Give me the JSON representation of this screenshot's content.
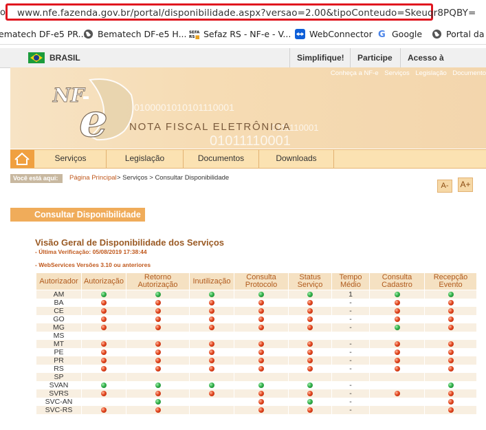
{
  "browser": {
    "url_prefix": "o",
    "url": "www.nfe.fazenda.gov.br/portal/disponibilidade.aspx?versao=2.00&tipoConteudo=Skeuqr8PQBY=",
    "bookmarks": [
      "ematech DF-e5 PR...",
      "Bematech DF-e5 H...",
      "Sefaz RS - NF-e - V...",
      "WebConnector",
      "Google",
      "Portal da N"
    ]
  },
  "gov_bar": {
    "country": "BRASIL",
    "links": [
      "Simplifique!",
      "Participe",
      "Acesso à informação"
    ]
  },
  "banner": {
    "top_links": [
      "Conheça a NF-e",
      "Serviços",
      "Legislação",
      "Documento"
    ],
    "logo_text": "NF-e",
    "title": "NOTA FISCAL ELETRÔNICA",
    "binary_1": "0100001010101110001",
    "binary_2": "0111110001",
    "binary_3": "01011110001"
  },
  "nav": {
    "items": [
      "Serviços",
      "Legislação",
      "Documentos",
      "Downloads"
    ]
  },
  "breadcrumb": {
    "label": "Você está aqui:",
    "home": "Página Principal",
    "rest": "> Serviços > Consultar Disponibilidade"
  },
  "font_controls": {
    "decrease": "A-",
    "increase": "A+"
  },
  "section": {
    "header": "Consultar Disponibilidade",
    "title": "Visão Geral de Disponibilidade dos Serviços",
    "last_check": "- Última Verificação: 05/08/2019 17:38:44",
    "versions": "- WebServices Versões 3.10 ou anteriores"
  },
  "table": {
    "headers": [
      "Autorizador",
      "Autorização",
      "Retorno Autorização",
      "Inutilização",
      "Consulta Protocolo",
      "Status Serviço",
      "Tempo Médio",
      "Consulta Cadastro",
      "Recepção Evento"
    ],
    "rows": [
      [
        "AM",
        "green",
        "green",
        "green",
        "green",
        "green",
        "1",
        "green",
        "green"
      ],
      [
        "BA",
        "red",
        "red",
        "red",
        "red",
        "red",
        "-",
        "red",
        "red"
      ],
      [
        "CE",
        "red",
        "red",
        "red",
        "red",
        "red",
        "-",
        "red",
        "red"
      ],
      [
        "GO",
        "red",
        "red",
        "red",
        "red",
        "red",
        "-",
        "red",
        "red"
      ],
      [
        "MG",
        "red",
        "red",
        "red",
        "red",
        "red",
        "-",
        "green",
        "red"
      ],
      [
        "MS",
        "",
        "",
        "",
        "",
        "",
        "",
        "",
        ""
      ],
      [
        "MT",
        "red",
        "red",
        "red",
        "red",
        "red",
        "-",
        "red",
        "red"
      ],
      [
        "PE",
        "red",
        "red",
        "red",
        "red",
        "red",
        "-",
        "red",
        "red"
      ],
      [
        "PR",
        "red",
        "red",
        "red",
        "red",
        "red",
        "-",
        "red",
        "red"
      ],
      [
        "RS",
        "red",
        "red",
        "red",
        "red",
        "red",
        "-",
        "red",
        "red"
      ],
      [
        "SP",
        "",
        "",
        "",
        "",
        "",
        "",
        "",
        ""
      ],
      [
        "SVAN",
        "green",
        "green",
        "green",
        "green",
        "green",
        "-",
        "",
        "green"
      ],
      [
        "SVRS",
        "red",
        "red",
        "red",
        "red",
        "red",
        "-",
        "red",
        "red"
      ],
      [
        "SVC-AN",
        "",
        "green",
        "",
        "red",
        "green",
        "-",
        "",
        "red"
      ],
      [
        "SVC-RS",
        "red",
        "red",
        "",
        "red",
        "red",
        "-",
        "",
        "red"
      ]
    ]
  },
  "colors": {
    "highlight": "#e0141e",
    "accent": "#f0ac5a",
    "title": "#9a5a24",
    "status_ok": "#32b04a",
    "status_fail": "#e2461e"
  }
}
